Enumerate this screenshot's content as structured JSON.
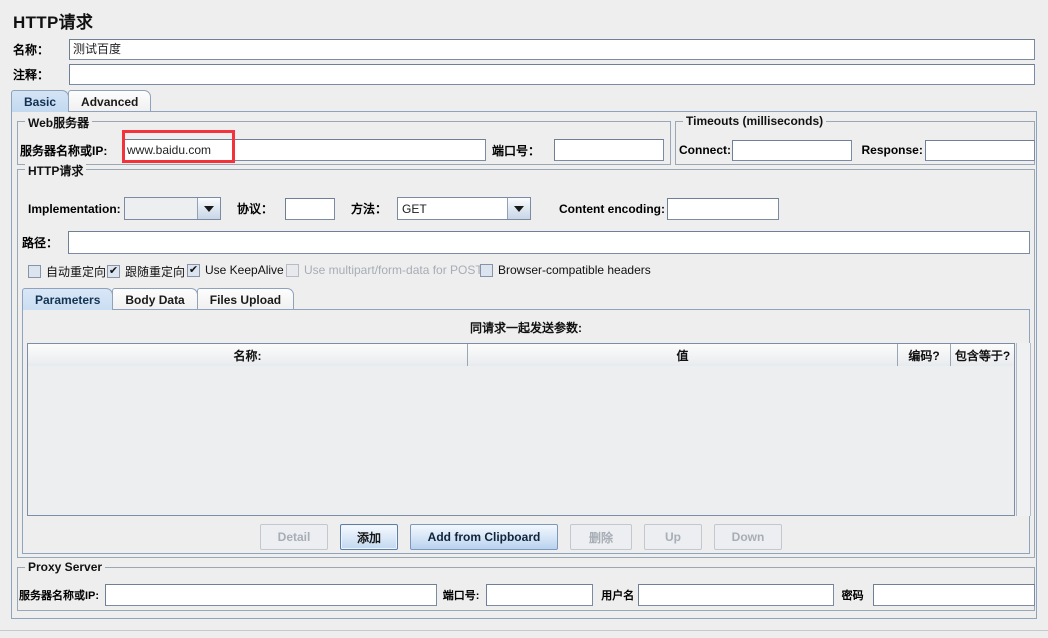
{
  "page": {
    "title": "HTTP请求"
  },
  "meta": {
    "name_label": "名称：",
    "name_value": "测试百度",
    "comment_label": "注释：",
    "comment_value": ""
  },
  "main_tabs": [
    {
      "label": "Basic",
      "selected": true
    },
    {
      "label": "Advanced",
      "selected": false
    }
  ],
  "web_server": {
    "group_title": "Web服务器",
    "host_label": "服务器名称或IP:",
    "host_value": "www.baidu.com",
    "port_label": "端口号：",
    "port_value": ""
  },
  "timeouts": {
    "group_title": "Timeouts (milliseconds)",
    "connect_label": "Connect:",
    "connect_value": "",
    "response_label": "Response:",
    "response_value": ""
  },
  "http_request": {
    "group_title": "HTTP请求",
    "implementation_label": "Implementation:",
    "implementation_value": "",
    "protocol_label": "协议：",
    "protocol_value": "",
    "method_label": "方法：",
    "method_value": "GET",
    "content_encoding_label": "Content encoding:",
    "content_encoding_value": "",
    "path_label": "路径：",
    "path_value": "",
    "checkboxes": [
      {
        "label": "自动重定向",
        "checked": false,
        "disabled": false
      },
      {
        "label": "跟随重定向",
        "checked": true,
        "disabled": false
      },
      {
        "label": "Use KeepAlive",
        "checked": true,
        "disabled": false
      },
      {
        "label": "Use multipart/form-data for POST",
        "checked": false,
        "disabled": true
      },
      {
        "label": "Browser-compatible headers",
        "checked": false,
        "disabled": false
      }
    ]
  },
  "param_tabs": [
    {
      "label": "Parameters",
      "selected": true
    },
    {
      "label": "Body Data",
      "selected": false
    },
    {
      "label": "Files Upload",
      "selected": false
    }
  ],
  "parameters": {
    "caption": "同请求一起发送参数:",
    "columns": [
      "名称:",
      "值",
      "编码?",
      "包含等于?"
    ],
    "rows": [],
    "buttons": [
      {
        "label": "Detail",
        "state": "disabled"
      },
      {
        "label": "添加",
        "state": "focus"
      },
      {
        "label": "Add from Clipboard",
        "state": "primary"
      },
      {
        "label": "删除",
        "state": "disabled"
      },
      {
        "label": "Up",
        "state": "disabled"
      },
      {
        "label": "Down",
        "state": "disabled"
      }
    ]
  },
  "proxy_server": {
    "group_title": "Proxy Server",
    "host_label": "服务器名称或IP:",
    "host_value": "",
    "port_label": "端口号:",
    "port_value": "",
    "user_label": "用户名",
    "user_value": "",
    "password_label": "密码",
    "password_value": ""
  },
  "annotation": {
    "color": "#f4323c",
    "target": "server-host-input"
  }
}
